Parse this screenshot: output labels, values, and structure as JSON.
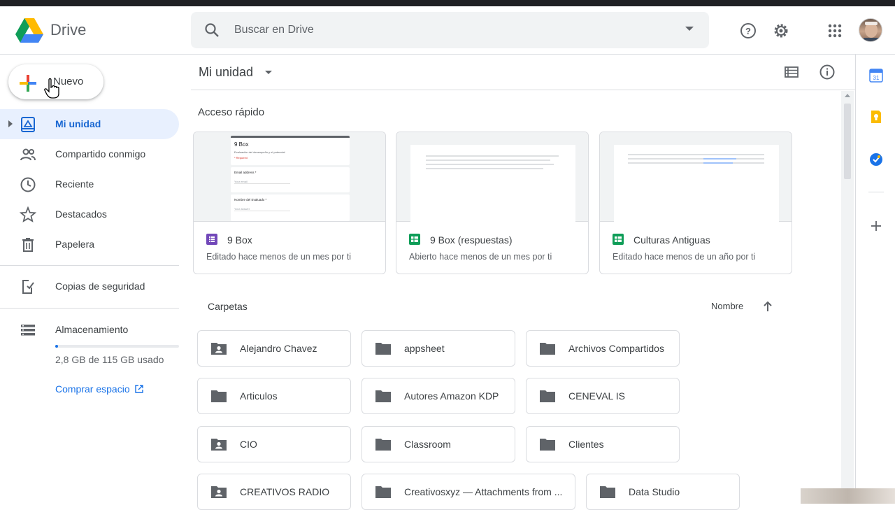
{
  "app": {
    "name": "Drive"
  },
  "search": {
    "placeholder": "Buscar en Drive"
  },
  "header": {
    "icons": [
      "help-icon",
      "settings-icon",
      "apps-grid-icon"
    ]
  },
  "new_button": {
    "label": "Nuevo"
  },
  "sidebar": {
    "items": [
      {
        "label": "Mi unidad",
        "icon": "my-drive-icon",
        "active": true
      },
      {
        "label": "Compartido conmigo",
        "icon": "shared-icon"
      },
      {
        "label": "Reciente",
        "icon": "clock-icon"
      },
      {
        "label": "Destacados",
        "icon": "star-icon"
      },
      {
        "label": "Papelera",
        "icon": "trash-icon"
      },
      {
        "label": "Copias de seguridad",
        "icon": "backup-icon"
      },
      {
        "label": "Almacenamiento",
        "icon": "storage-icon"
      }
    ],
    "storage": {
      "used_text": "2,8 GB de 115 GB usado",
      "fraction": 0.024
    },
    "buy_label": "Comprar espacio"
  },
  "main": {
    "title": "Mi unidad",
    "quick_access_label": "Acceso rápido",
    "quick_access": [
      {
        "name": "9 Box",
        "sub": "Editado hace menos de un mes por ti",
        "type": "form",
        "color": "#7248b9",
        "preview": {
          "title": "9 Box",
          "desc": "Evaluación del desempeño y el potencial",
          "required": "* Required",
          "field1": "Email address *",
          "field1_hint": "Your email",
          "field2": "Nombre del Evaluado *",
          "field2_hint": "Your answer"
        }
      },
      {
        "name": "9 Box (respuestas)",
        "sub": "Abierto hace menos de un mes por ti",
        "type": "sheet",
        "color": "#0f9d58"
      },
      {
        "name": "Culturas Antiguas",
        "sub": "Editado hace menos de un año por ti",
        "type": "sheet",
        "color": "#0f9d58"
      }
    ],
    "folders_label": "Carpetas",
    "sort_label": "Nombre",
    "folders": [
      {
        "name": "Alejandro Chavez",
        "shared": true
      },
      {
        "name": "appsheet",
        "shared": false
      },
      {
        "name": "Archivos Compartidos",
        "shared": false
      },
      {
        "name": "Articulos",
        "shared": false
      },
      {
        "name": "Autores Amazon KDP",
        "shared": false
      },
      {
        "name": "CENEVAL IS",
        "shared": false
      },
      {
        "name": "CIO",
        "shared": true
      },
      {
        "name": "Classroom",
        "shared": false
      },
      {
        "name": "Clientes",
        "shared": false
      },
      {
        "name": "CREATIVOS RADIO",
        "shared": true
      },
      {
        "name": "Creativosxyz — Attachments from ...",
        "shared": false
      },
      {
        "name": "Data Studio",
        "shared": false
      }
    ]
  },
  "right_rail": {
    "icons": [
      "calendar-icon",
      "keep-icon",
      "tasks-icon",
      "add-icon"
    ],
    "calendar_day": "31"
  },
  "colors": {
    "accent": "#1a73e8",
    "active_bg": "#e8f0fe",
    "form": "#7248b9",
    "sheet": "#0f9d58"
  }
}
